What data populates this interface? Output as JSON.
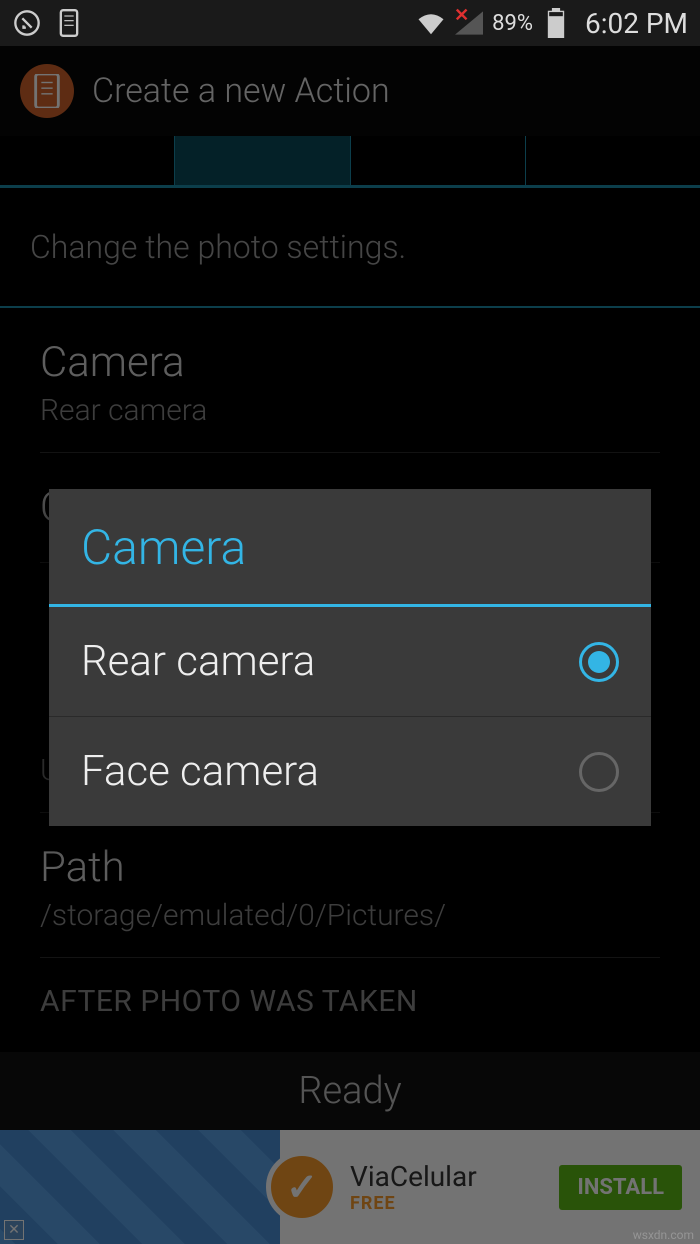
{
  "status": {
    "battery_percent": "89%",
    "clock": "6:02 PM"
  },
  "header": {
    "title": "Create a new Action"
  },
  "subtitle": "Change the photo settings.",
  "settings": {
    "camera": {
      "label": "Camera",
      "value": "Rear camera"
    },
    "quality": {
      "label": "Quality"
    },
    "autofocus": {
      "value": "Use autofocus while taking a picture"
    },
    "path": {
      "label": "Path",
      "value": "/storage/emulated/0/Pictures/"
    },
    "section_after": "AFTER PHOTO WAS TAKEN"
  },
  "dialog": {
    "title": "Camera",
    "options": [
      {
        "label": "Rear camera",
        "selected": true
      },
      {
        "label": "Face camera",
        "selected": false
      }
    ]
  },
  "ready_bar": "Ready",
  "ad": {
    "brand": "ViaCelular",
    "free": "FREE",
    "install": "INSTALL"
  },
  "watermark": "wsxdn.com"
}
